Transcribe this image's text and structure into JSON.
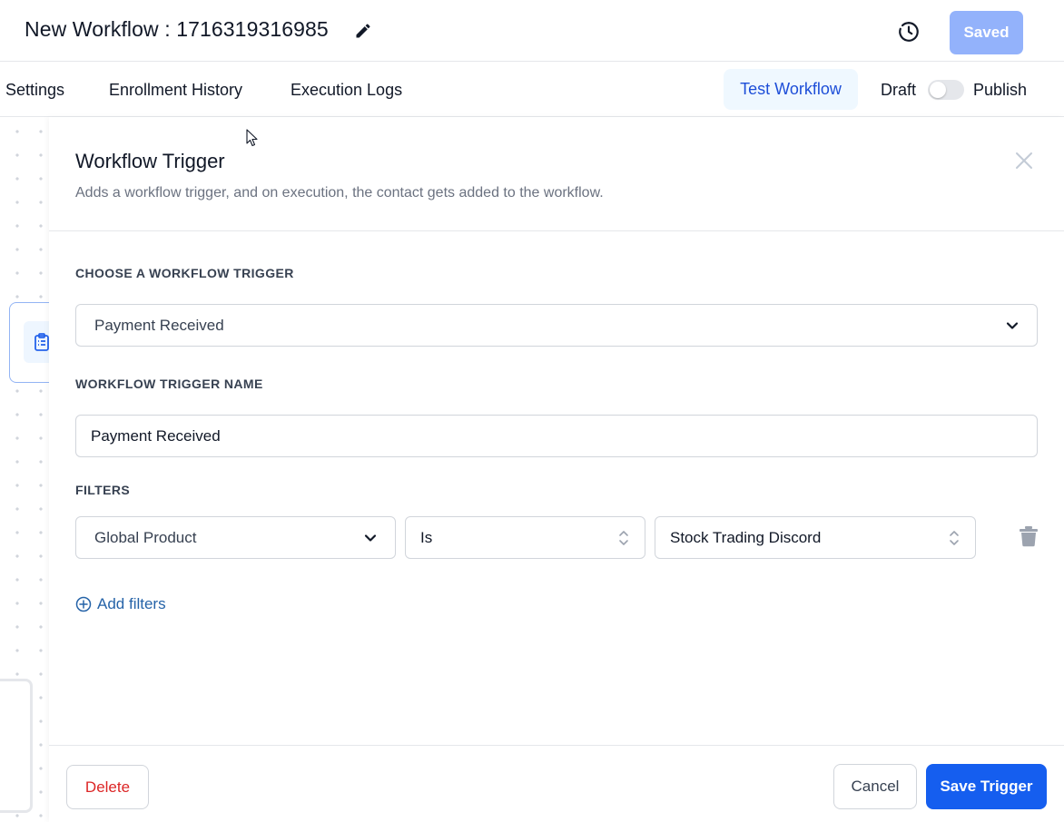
{
  "header": {
    "title": "New Workflow : 1716319316985",
    "saved_label": "Saved"
  },
  "nav": {
    "tabs": [
      {
        "label": "Settings"
      },
      {
        "label": "Enrollment History"
      },
      {
        "label": "Execution Logs"
      }
    ],
    "test_workflow_label": "Test Workflow",
    "draft_label": "Draft",
    "publish_label": "Publish",
    "publish_toggle_on": false
  },
  "panel": {
    "title": "Workflow Trigger",
    "subtitle": "Adds a workflow trigger, and on execution, the contact gets added to the workflow.",
    "trigger_section_label": "CHOOSE A WORKFLOW TRIGGER",
    "trigger_value": "Payment Received",
    "name_section_label": "WORKFLOW TRIGGER NAME",
    "name_value": "Payment Received",
    "filters_section_label": "FILTERS",
    "filter": {
      "field": "Global Product",
      "operator": "Is",
      "value": "Stock Trading Discord"
    },
    "add_filters_label": "Add filters",
    "delete_label": "Delete",
    "cancel_label": "Cancel",
    "save_label": "Save Trigger"
  },
  "icons": {
    "edit": "pencil-icon",
    "history": "history-icon",
    "close": "close-icon",
    "trash": "trash-icon",
    "add": "plus-circle-icon",
    "node": "clipboard-list-icon"
  },
  "colors": {
    "primary": "#155eef",
    "saved_disabled": "#93b2fb",
    "danger": "#dc2626",
    "link": "#2563a8"
  }
}
